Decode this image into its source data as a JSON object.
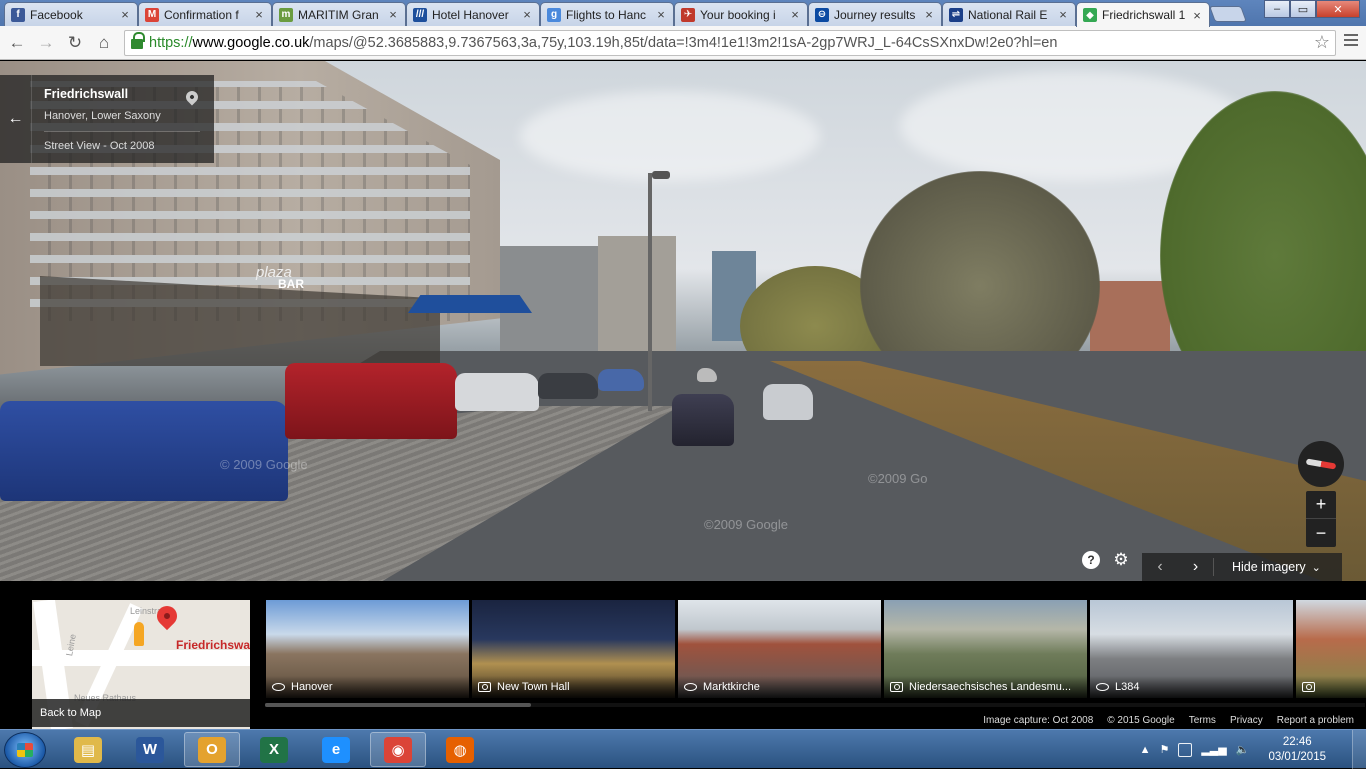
{
  "browser": {
    "tabs": [
      {
        "title": "Facebook",
        "favicon": "facebook-icon",
        "color": "#3b5998",
        "glyph": "f"
      },
      {
        "title": "Confirmation f",
        "favicon": "gmail-icon",
        "color": "#db4437",
        "glyph": "M"
      },
      {
        "title": "MARITIM Gran",
        "favicon": "hotel-icon",
        "color": "#6a9c3f",
        "glyph": "m"
      },
      {
        "title": "Hotel Hanover",
        "favicon": "booking-icon",
        "color": "#1d4f9c",
        "glyph": "///"
      },
      {
        "title": "Flights to Hanc",
        "favicon": "google-icon",
        "color": "#4a89dc",
        "glyph": "g"
      },
      {
        "title": "Your booking i",
        "favicon": "airline-icon",
        "color": "#c0392b",
        "glyph": "✈"
      },
      {
        "title": "Journey results",
        "favicon": "tfl-icon",
        "color": "#0b4aa2",
        "glyph": "⊖"
      },
      {
        "title": "National Rail E",
        "favicon": "national-rail-icon",
        "color": "#1b3f88",
        "glyph": "⇌"
      },
      {
        "title": "Friedrichswall 1",
        "favicon": "maps-icon",
        "color": "#34a853",
        "glyph": "◆"
      }
    ],
    "url": {
      "scheme": "https://",
      "host": "www.google.co.uk",
      "rest": "/maps/@52.3685883,9.7367563,3a,75y,103.19h,85t/data=!3m4!1e1!3m2!1sA-2gp7WRJ_L-64CsSXnxDw!2e0?hl=en"
    }
  },
  "streetview": {
    "address_title": "Friedrichswall",
    "address_sub": "Hanover, Lower Saxony",
    "capture_label": "Street View - Oct 2008",
    "watermark_1": "© 2009 Google",
    "watermark_2": "©2009 Go",
    "watermark_3": "©2009 Google",
    "sign_text": "BAR",
    "sign_script": "plaza",
    "hide_imagery": "Hide imagery",
    "zoom_in": "+",
    "zoom_out": "−",
    "help": "?",
    "settings": "⚙"
  },
  "filmstrip": {
    "minimap_label": "Friedrichswa",
    "minimap_street_1": "Leinstraße",
    "minimap_street_2": "Leine",
    "minimap_street_3": "Neues Rathaus",
    "back_to_map": "Back to Map",
    "thumbnails": [
      {
        "caption": "Hanover",
        "kind": "pano"
      },
      {
        "caption": "New Town Hall",
        "kind": "photo"
      },
      {
        "caption": "Marktkirche",
        "kind": "pano"
      },
      {
        "caption": "Niedersaechsisches Landesmu...",
        "kind": "photo"
      },
      {
        "caption": "L384",
        "kind": "pano"
      },
      {
        "caption": "",
        "kind": "photo"
      }
    ],
    "footer": {
      "capture": "Image capture: Oct 2008",
      "copyright": "© 2015 Google",
      "terms": "Terms",
      "privacy": "Privacy",
      "report": "Report a problem"
    }
  },
  "taskbar": {
    "apps": [
      {
        "name": "file-explorer",
        "glyph": "▤",
        "color": "#e0b94a",
        "open": false
      },
      {
        "name": "word",
        "glyph": "W",
        "color": "#2b579a",
        "open": false
      },
      {
        "name": "outlook",
        "glyph": "O",
        "color": "#e4a22e",
        "open": true
      },
      {
        "name": "excel",
        "glyph": "X",
        "color": "#217346",
        "open": false
      },
      {
        "name": "internet-explorer",
        "glyph": "e",
        "color": "#1e90ff",
        "open": false
      },
      {
        "name": "chrome",
        "glyph": "◉",
        "color": "#db4437",
        "open": true
      },
      {
        "name": "firefox",
        "glyph": "◍",
        "color": "#e66000",
        "open": false
      }
    ],
    "time": "22:46",
    "date": "03/01/2015"
  }
}
